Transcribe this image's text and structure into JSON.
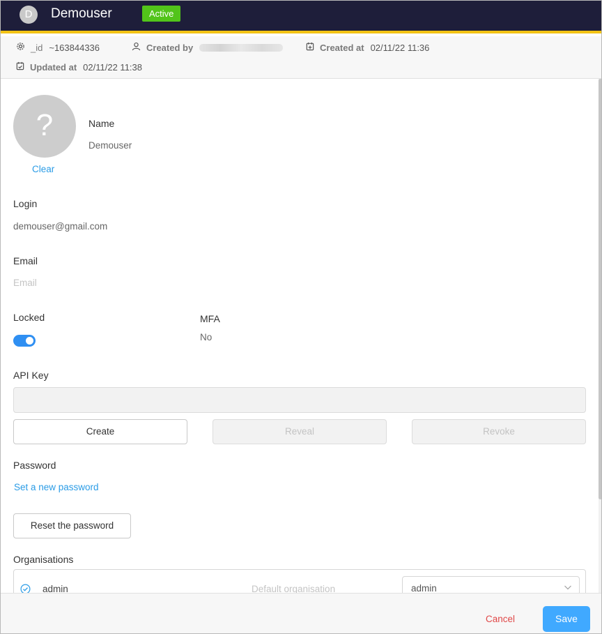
{
  "header": {
    "avatar_initial": "D",
    "title": "Demouser",
    "status_badge": "Active",
    "background_color": "#1e1e3a",
    "accent_color": "#f3c316",
    "badge_color": "#52c41a"
  },
  "meta": {
    "id_label": "_id",
    "id_value": "~163844336",
    "created_by_label": "Created by",
    "created_at_label": "Created at",
    "created_at_value": "02/11/22 11:36",
    "updated_at_label": "Updated at",
    "updated_at_value": "02/11/22 11:38"
  },
  "profile": {
    "avatar_placeholder": "?",
    "clear_label": "Clear",
    "name_label": "Name",
    "name_value": "Demouser"
  },
  "login": {
    "label": "Login",
    "value": "demouser@gmail.com"
  },
  "email": {
    "label": "Email",
    "placeholder": "Email"
  },
  "locked": {
    "label": "Locked",
    "enabled": true
  },
  "mfa": {
    "label": "MFA",
    "value": "No"
  },
  "api_key": {
    "label": "API Key",
    "value": "",
    "create_label": "Create",
    "reveal_label": "Reveal",
    "revoke_label": "Revoke"
  },
  "password": {
    "label": "Password",
    "set_new_label": "Set a new password",
    "reset_label": "Reset the password"
  },
  "organisations": {
    "label": "Organisations",
    "rows": [
      {
        "name": "admin",
        "default_label": "Default organisation",
        "profile": "admin"
      }
    ]
  },
  "footer": {
    "cancel_label": "Cancel",
    "save_label": "Save",
    "save_color": "#40a9ff"
  }
}
